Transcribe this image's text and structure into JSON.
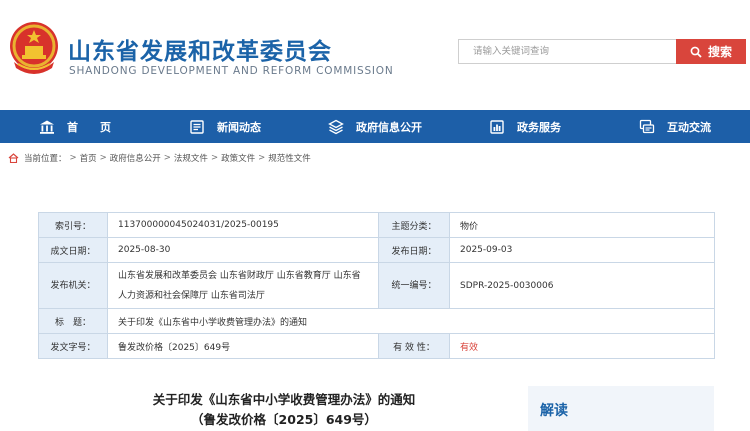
{
  "header": {
    "title": "山东省发展和改革委员会",
    "subtitle": "SHANDONG DEVELOPMENT AND REFORM COMMISSION",
    "search_placeholder": "请输入关键词查询",
    "search_label": "搜索"
  },
  "nav": {
    "items": [
      {
        "label": "首　　页",
        "icon": "home-icon"
      },
      {
        "label": "新闻动态",
        "icon": "news-icon"
      },
      {
        "label": "政府信息公开",
        "icon": "info-icon"
      },
      {
        "label": "政务服务",
        "icon": "service-icon"
      },
      {
        "label": "互动交流",
        "icon": "chat-icon"
      }
    ]
  },
  "breadcrumb": {
    "prefix": "当前位置：",
    "items": [
      "首页",
      "政府信息公开",
      "法规文件",
      "政策文件",
      "规范性文件"
    ]
  },
  "info": {
    "index_label": "索引号：",
    "index_value": "113700000045024031/2025-00195",
    "category_label": "主题分类：",
    "category_value": "物价",
    "created_label": "成文日期：",
    "created_value": "2025-08-30",
    "published_label": "发布日期：",
    "published_value": "2025-09-03",
    "issuer_label": "发布机关：",
    "issuer_value": "山东省发展和改革委员会 山东省财政厅 山东省教育厅 山东省人力资源和社会保障厅 山东省司法厅",
    "code_label": "统一编号：",
    "code_value": "SDPR-2025-0030006",
    "title_label": "标　题：",
    "title_value": "关于印发《山东省中小学收费管理办法》的通知",
    "docno_label": "发文字号：",
    "docno_value": "鲁发改价格〔2025〕649号",
    "validity_label": "有 效 性：",
    "validity_value": "有效"
  },
  "article": {
    "title": "关于印发《山东省中小学收费管理办法》的通知",
    "number": "（鲁发改价格〔2025〕649号）"
  },
  "side": {
    "title": "解读"
  },
  "colors": {
    "brand_blue": "#1d5fa8",
    "search_red": "#d9453c",
    "label_bg": "#e5eef8"
  }
}
